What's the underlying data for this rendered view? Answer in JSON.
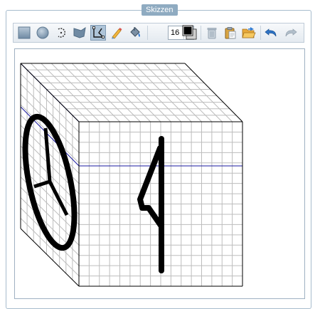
{
  "panel": {
    "title": "Skizzen"
  },
  "toolbar": {
    "tools": [
      {
        "name": "rectangle",
        "icon": "square-icon",
        "active": false
      },
      {
        "name": "circle",
        "icon": "circle-icon",
        "active": false
      },
      {
        "name": "arc",
        "icon": "arc-icon",
        "active": false
      },
      {
        "name": "fill-shape",
        "icon": "flag-shape-icon",
        "active": false
      },
      {
        "name": "polyline",
        "icon": "polyline-icon",
        "active": true
      },
      {
        "name": "pen",
        "icon": "pen-icon",
        "active": false
      },
      {
        "name": "fill",
        "icon": "paint-bucket-icon",
        "active": false
      }
    ],
    "line_width": "16",
    "color": "#000000",
    "actions": [
      {
        "name": "delete",
        "icon": "trash-icon",
        "enabled": false
      },
      {
        "name": "paste",
        "icon": "clipboard-icon",
        "enabled": true
      },
      {
        "name": "open",
        "icon": "open-folder-icon",
        "enabled": true
      },
      {
        "name": "undo",
        "icon": "undo-icon",
        "enabled": true
      },
      {
        "name": "redo",
        "icon": "redo-icon",
        "enabled": false
      }
    ]
  },
  "colors": {
    "accent": "#8fabc1",
    "grid": "#bdbdbd",
    "guide": "#1a1aa0",
    "stroke": "#000000"
  }
}
